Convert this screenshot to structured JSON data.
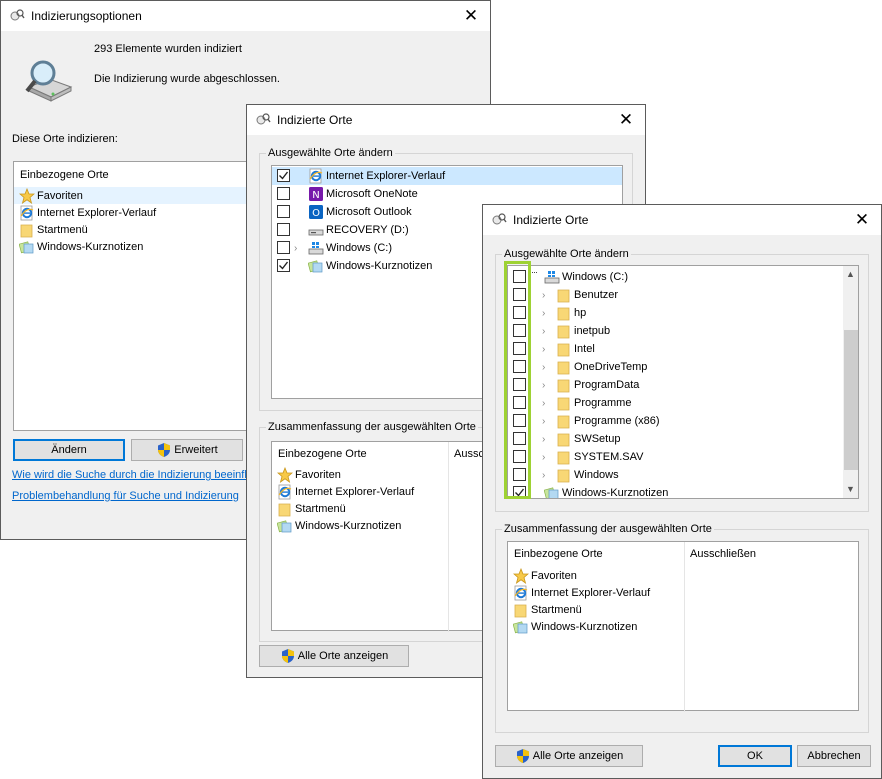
{
  "win1": {
    "title": "Indizierungsoptionen",
    "status_count": "293 Elemente wurden indiziert",
    "status_done": "Die Indizierung wurde abgeschlossen.",
    "section_label": "Diese Orte indizieren:",
    "column_header": "Einbezogene Orte",
    "items": [
      "Favoriten",
      "Internet Explorer-Verlauf",
      "Startmenü",
      "Windows-Kurznotizen"
    ],
    "btn_modify": "Ändern",
    "btn_advanced": "Erweitert",
    "link_how": "Wie wird die Suche durch die Indizierung beeinflu",
    "link_troubleshoot": "Problembehandlung für Suche und Indizierung"
  },
  "win2": {
    "title": "Indizierte Orte",
    "group_change": "Ausgewählte Orte ändern",
    "items": [
      "Internet Explorer-Verlauf",
      "Microsoft OneNote",
      "Microsoft Outlook",
      "RECOVERY (D:)",
      "Windows (C:)",
      "Windows-Kurznotizen"
    ],
    "group_summary": "Zusammenfassung der ausgewählten Orte",
    "summary_header_included": "Einbezogene Orte",
    "summary_header_excluded": "Ausschl",
    "summary_items": [
      "Favoriten",
      "Internet Explorer-Verlauf",
      "Startmenü",
      "Windows-Kurznotizen"
    ],
    "btn_show_all": "Alle Orte anzeigen"
  },
  "win3": {
    "title": "Indizierte Orte",
    "group_change": "Ausgewählte Orte ändern",
    "tree_root": "Windows (C:)",
    "folders": [
      "Benutzer",
      "hp",
      "inetpub",
      "Intel",
      "OneDriveTemp",
      "ProgramData",
      "Programme",
      "Programme (x86)",
      "SWSetup",
      "SYSTEM.SAV",
      "Windows"
    ],
    "tree_last": "Windows-Kurznotizen",
    "group_summary": "Zusammenfassung der ausgewählten Orte",
    "summary_header_included": "Einbezogene Orte",
    "summary_header_excluded": "Ausschließen",
    "summary_items": [
      "Favoriten",
      "Internet Explorer-Verlauf",
      "Startmenü",
      "Windows-Kurznotizen"
    ],
    "btn_show_all": "Alle Orte anzeigen",
    "btn_ok": "OK",
    "btn_cancel": "Abbrechen"
  },
  "colors": {
    "highlight_green": "#9ed233",
    "selection_blue": "#cce8ff",
    "link_blue": "#0066cc",
    "default_button_border": "#0078d7"
  }
}
